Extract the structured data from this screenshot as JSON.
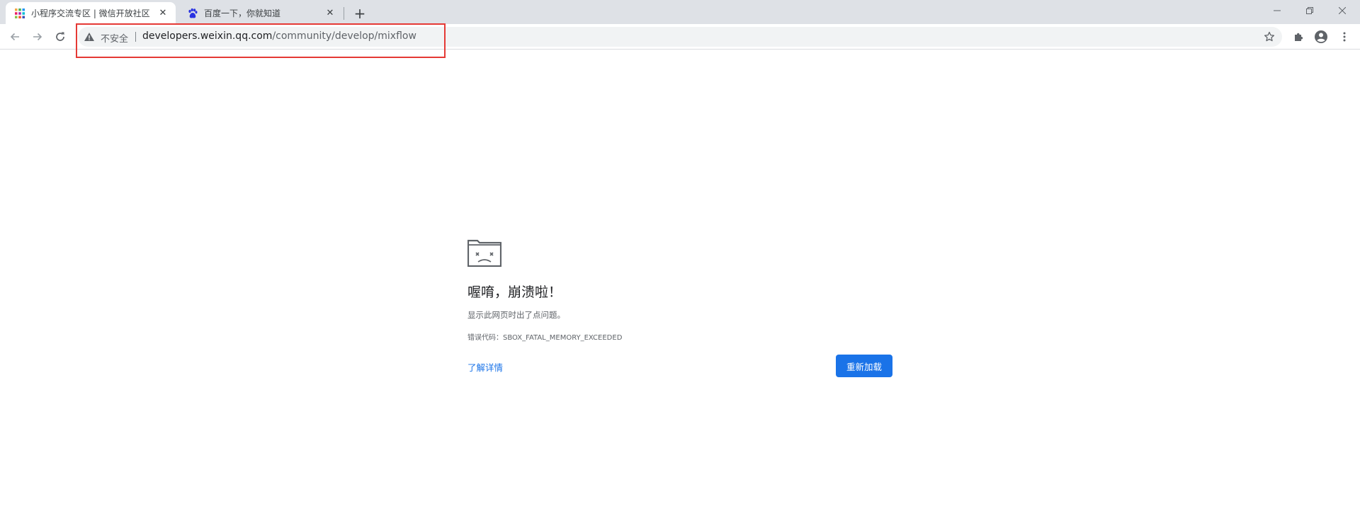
{
  "tabs": [
    {
      "title": "小程序交流专区 | 微信开放社区",
      "favicon": "wechat-dev-grid-icon"
    },
    {
      "title": "百度一下，你就知道",
      "favicon": "baidu-paw-icon"
    }
  ],
  "omnibox": {
    "security_label": "不安全",
    "url_host": "developers.weixin.qq.com",
    "url_path": "/community/develop/mixflow"
  },
  "error": {
    "title": "喔唷，崩溃啦！",
    "subtitle": "显示此网页时出了点问题。",
    "code_line": "错误代码：SBOX_FATAL_MEMORY_EXCEEDED",
    "learn_more": "了解详情",
    "reload_label": "重新加载"
  },
  "colors": {
    "accent": "#1a73e8",
    "highlight_box": "#e53935",
    "tabstrip_bg": "#dee1e6"
  }
}
